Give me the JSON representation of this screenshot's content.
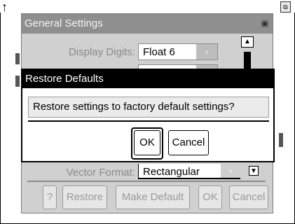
{
  "background": {
    "status_right_icon": "document-icon"
  },
  "general_settings": {
    "title": "General Settings",
    "display_digits": {
      "label": "Display Digits:",
      "value": "Float 6"
    },
    "vector_format": {
      "label": "Vector Format:",
      "value": "Rectangular"
    },
    "buttons": {
      "help": "?",
      "restore": "Restore",
      "make_default": "Make Default",
      "ok": "OK",
      "cancel": "Cancel"
    }
  },
  "restore_defaults": {
    "title": "Restore Defaults",
    "message": "Restore settings to factory default settings?",
    "ok": "OK",
    "cancel": "Cancel"
  },
  "colors": {
    "dialog_title_bg": "#000000",
    "general_title_bg": "#8f8f8f",
    "disabled_text": "#9a9a9a"
  }
}
